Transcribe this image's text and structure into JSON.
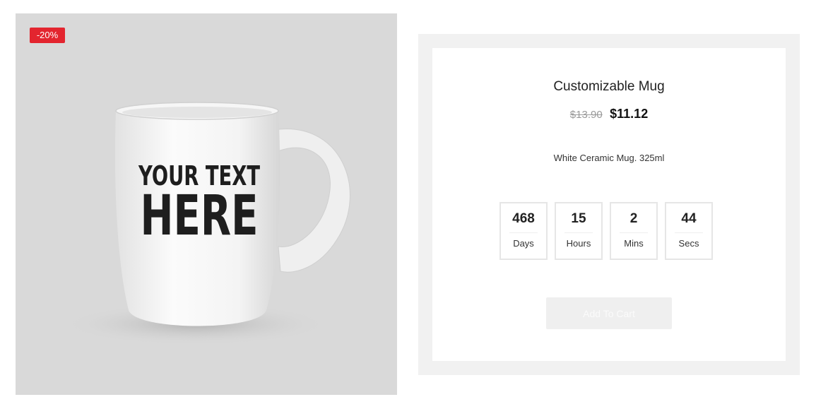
{
  "product": {
    "discount_badge": "-20%",
    "mug_text_line1": "YOUR TEXT",
    "mug_text_line2": "HERE",
    "title": "Customizable Mug",
    "old_price": "$13.90",
    "new_price": "$11.12",
    "description": "White Ceramic Mug. 325ml",
    "add_to_cart_label": "Add To Cart"
  },
  "countdown": [
    {
      "value": "468",
      "label": "Days"
    },
    {
      "value": "15",
      "label": "Hours"
    },
    {
      "value": "2",
      "label": "Mins"
    },
    {
      "value": "44",
      "label": "Secs"
    }
  ],
  "colors": {
    "badge": "#e3252f",
    "image_background": "#d9d9d9",
    "panel_frame": "#f1f1f1",
    "button_disabled": "#efefef"
  }
}
